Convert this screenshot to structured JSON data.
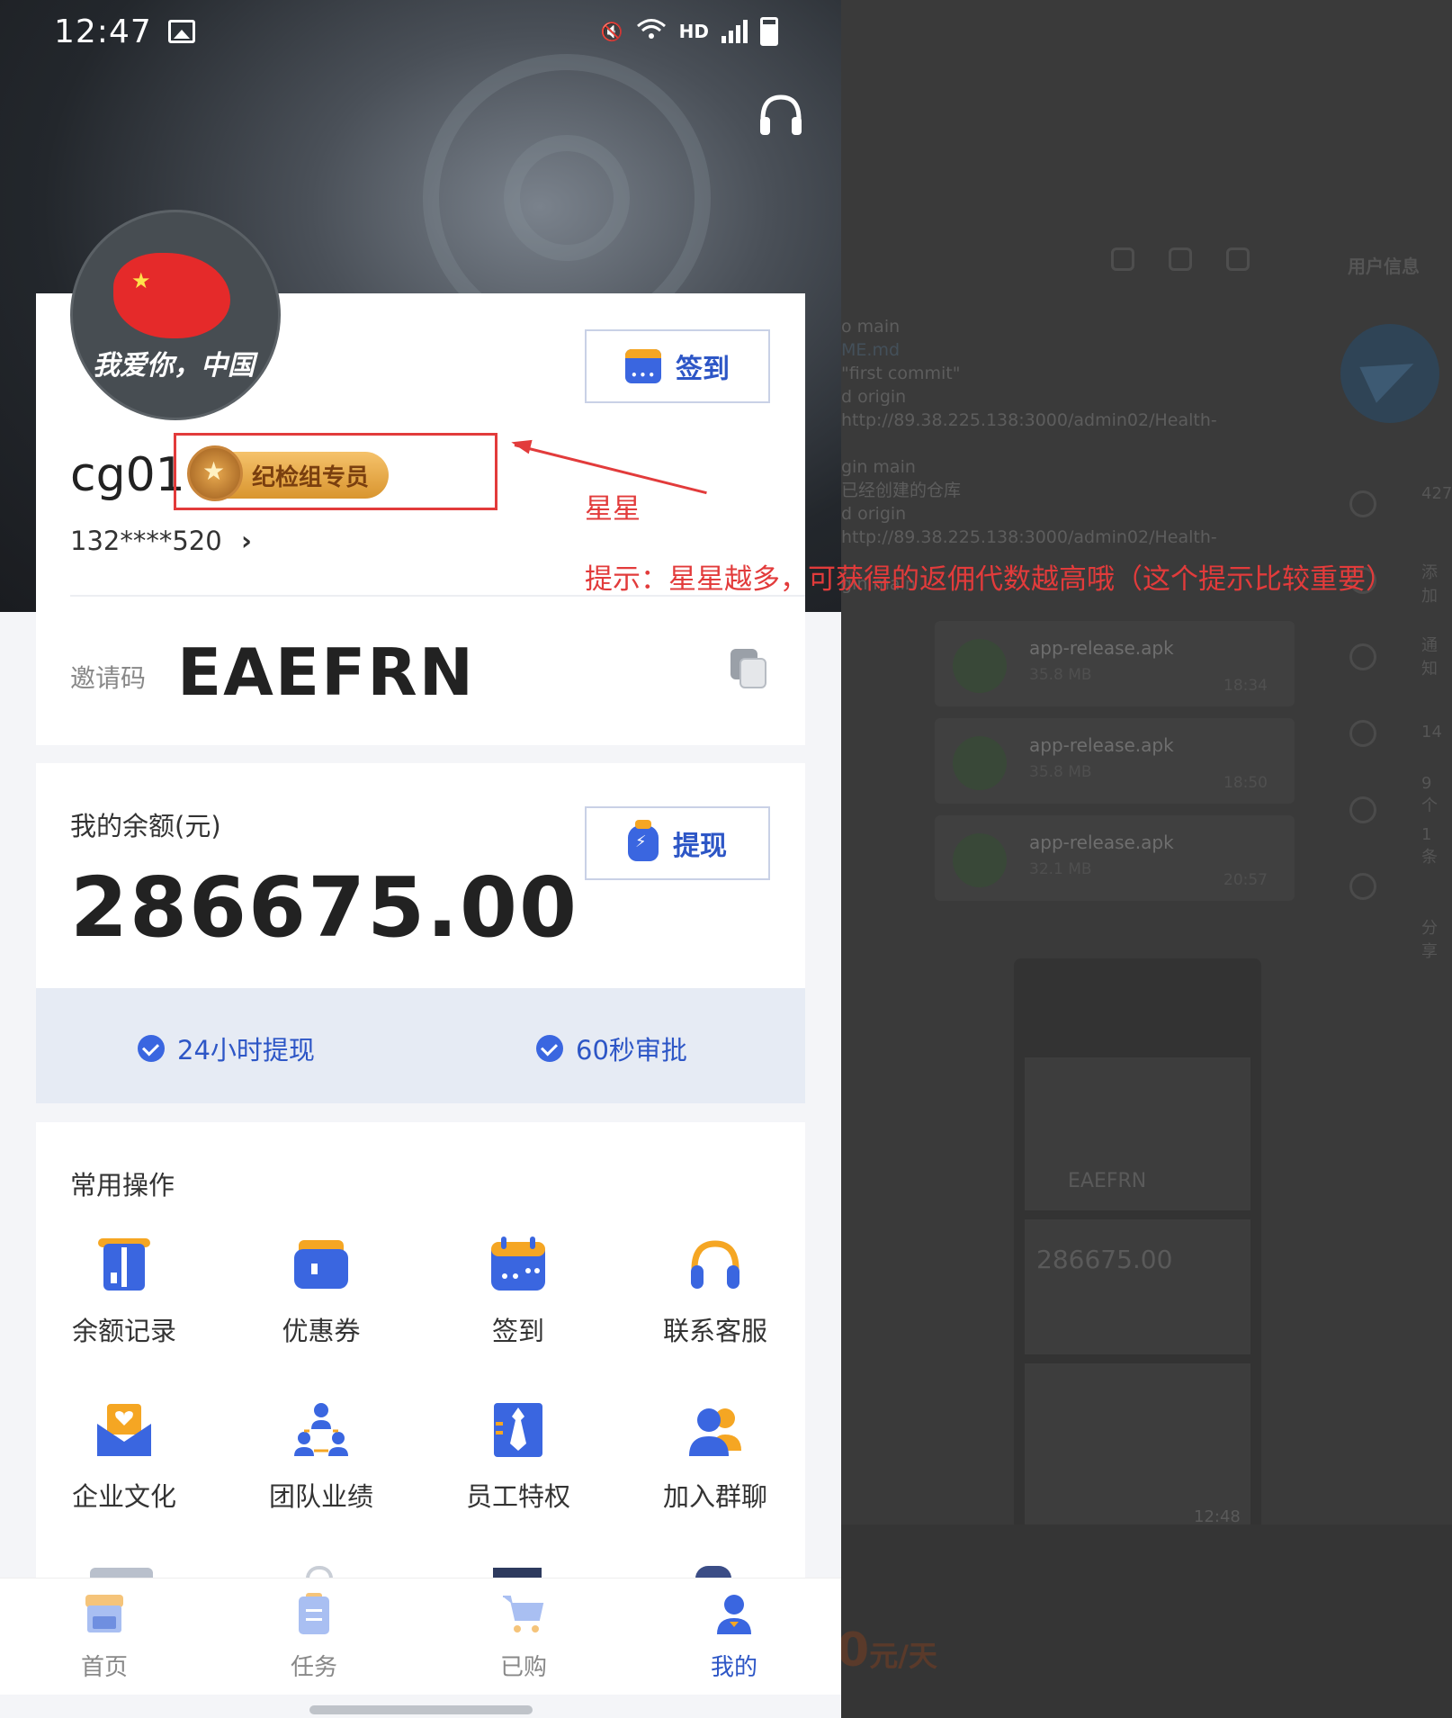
{
  "status_bar": {
    "time": "12:47",
    "network": "HD"
  },
  "profile": {
    "avatar_text": "我爱你，中国",
    "username": "cg01",
    "badge": "纪检组专员",
    "phone": "132****520",
    "phone_chevron": "›",
    "sign_in_label": "签到",
    "invite_label": "邀请码",
    "invite_code": "EAEFRN"
  },
  "balance": {
    "label": "我的余额(元)",
    "value": "286675.00",
    "withdraw_label": "提现"
  },
  "perks": [
    "24小时提现",
    "60秒审批"
  ],
  "operations": {
    "title": "常用操作",
    "items": [
      {
        "label": "余额记录",
        "icon": "balance-record-icon"
      },
      {
        "label": "优惠券",
        "icon": "coupon-icon"
      },
      {
        "label": "签到",
        "icon": "calendar-icon"
      },
      {
        "label": "联系客服",
        "icon": "headset-icon"
      },
      {
        "label": "企业文化",
        "icon": "envelope-heart-icon"
      },
      {
        "label": "团队业绩",
        "icon": "team-icon"
      },
      {
        "label": "员工特权",
        "icon": "tie-icon"
      },
      {
        "label": "加入群聊",
        "icon": "group-chat-icon"
      }
    ]
  },
  "tabs": [
    {
      "label": "首页",
      "icon": "home-icon",
      "active": false
    },
    {
      "label": "任务",
      "icon": "task-icon",
      "active": false
    },
    {
      "label": "已购",
      "icon": "cart-icon",
      "active": false
    },
    {
      "label": "我的",
      "icon": "user-icon",
      "active": true
    }
  ],
  "annotation": {
    "label": "星星",
    "tip": "提示：星星越多，可获得的返佣代数越高哦（这个提示比较重要）",
    "color": "#e23b3b"
  },
  "desktop": {
    "panel_title": "用户信息",
    "log_lines": [
      "o main",
      "ME.md",
      "\"first commit\"",
      "d origin http://89.38.225.138:3000/admin02/Health-",
      "gin main",
      "已经创建的仓库",
      "d origin http://89.38.225.138:3000/admin02/Health-",
      "gin main"
    ],
    "files": [
      {
        "name": "app-release.apk",
        "size": "35.8 MB",
        "time": "18:34"
      },
      {
        "name": "app-release.apk",
        "size": "35.8 MB",
        "time": "18:50"
      },
      {
        "name": "app-release.apk",
        "size": "32.1 MB",
        "time": "20:57"
      }
    ],
    "side_values": [
      "427",
      "添加",
      "通知",
      "14 ",
      "9 个",
      "1 条",
      "分享"
    ],
    "thumb_time": "12:48",
    "thumb_code": "EAEFRN",
    "thumb_balance": "286675.00",
    "price": "0",
    "price_unit": "元/天"
  },
  "colors": {
    "accent": "#2d56c6",
    "icon_blue": "#3a66e0",
    "icon_orange": "#f5a623",
    "annotation": "#e23b3b"
  }
}
